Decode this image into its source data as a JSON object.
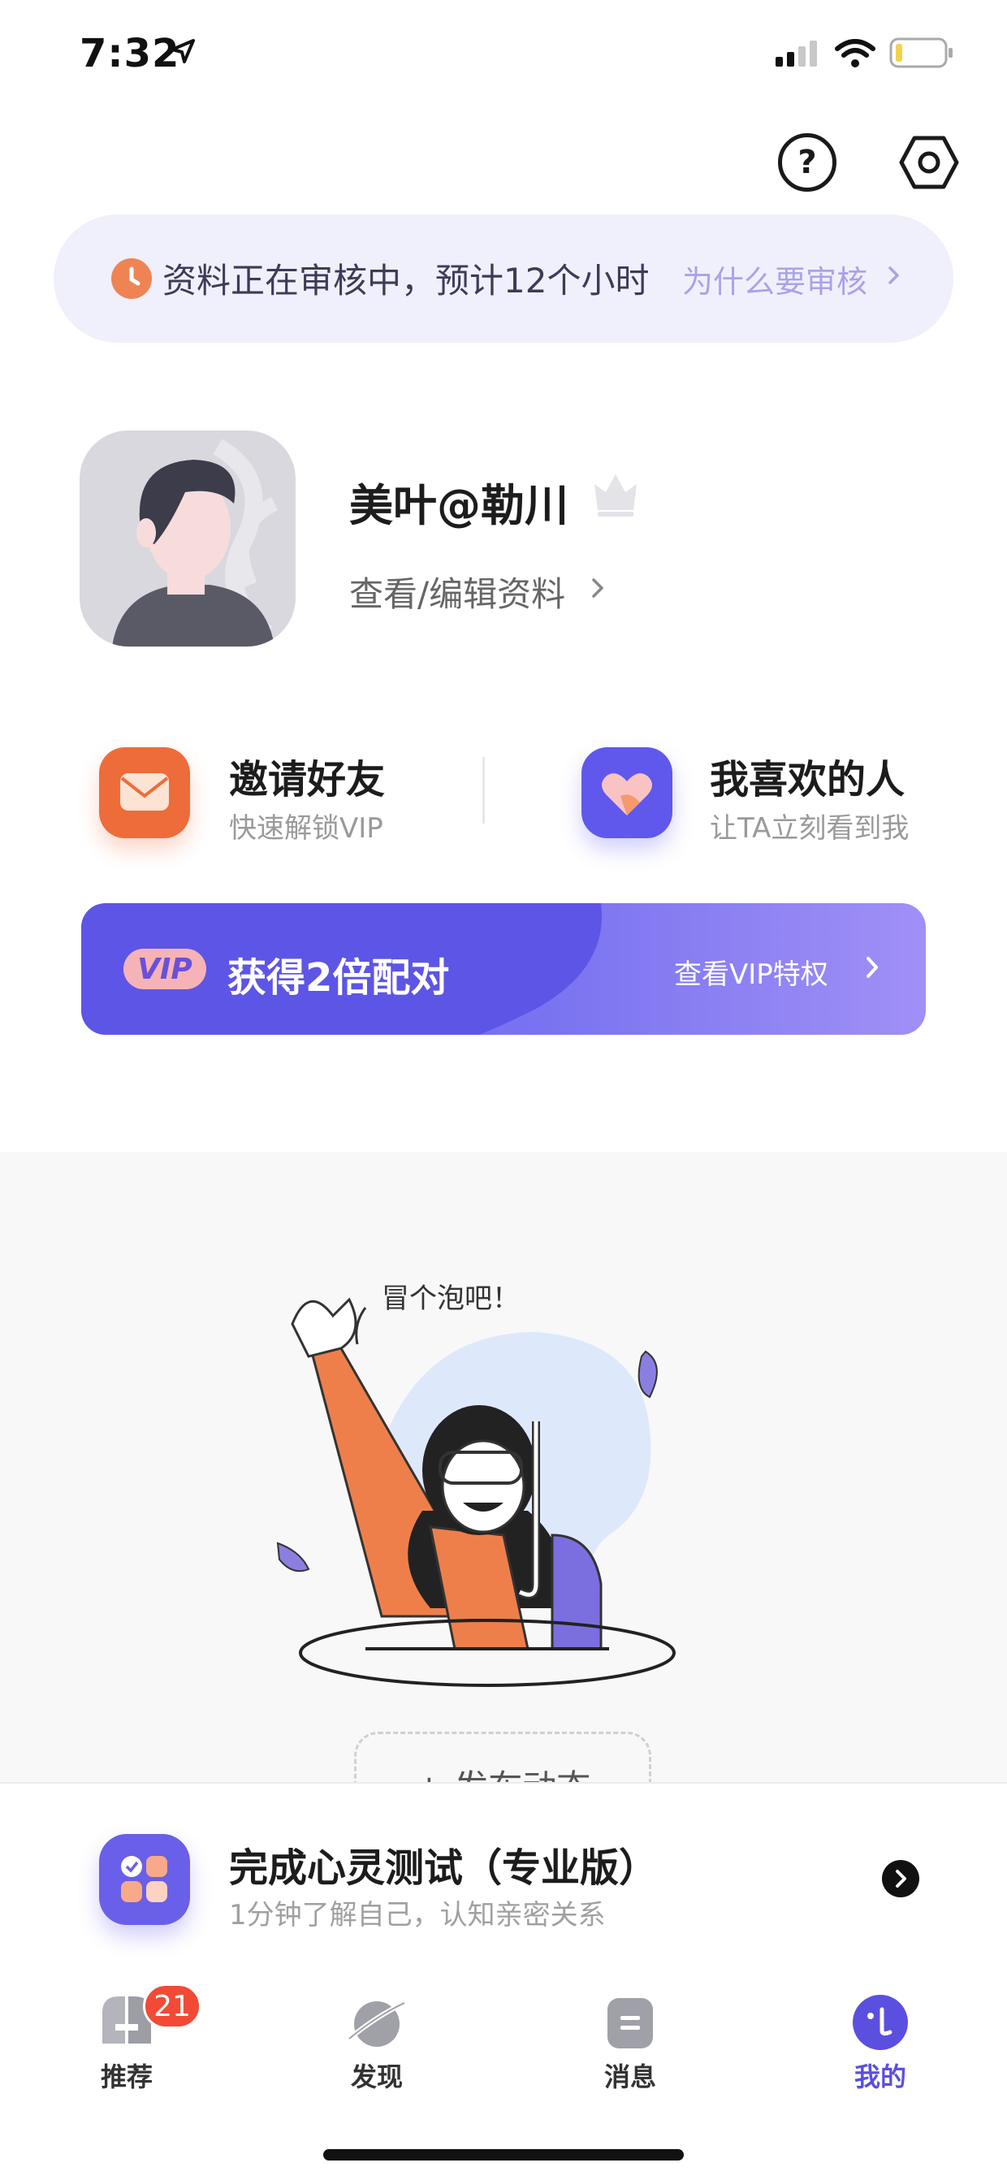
{
  "status_bar": {
    "time": "7:32"
  },
  "top_actions": {
    "help_label": "?"
  },
  "review_banner": {
    "text": "资料正在审核中，预计12个小时",
    "link": "为什么要审核"
  },
  "profile": {
    "name": "美叶@勒川",
    "edit_link": "查看/编辑资料"
  },
  "quick_actions": [
    {
      "title": "邀请好友",
      "subtitle": "快速解锁VIP"
    },
    {
      "title": "我喜欢的人",
      "subtitle": "让TA立刻看到我"
    }
  ],
  "vip_banner": {
    "badge": "VIP",
    "title": "获得2倍配对",
    "link": "查看VIP特权"
  },
  "feed_empty": {
    "bubble": "冒个泡吧！",
    "post_button": "+ 发布动态"
  },
  "test_card": {
    "title": "完成心灵测试（专业版）",
    "subtitle": "1分钟了解自己，认知亲密关系"
  },
  "tabs": [
    {
      "label": "推荐",
      "badge": "21",
      "active": false
    },
    {
      "label": "发现",
      "active": false
    },
    {
      "label": "消息",
      "active": false
    },
    {
      "label": "我的",
      "active": true
    }
  ],
  "colors": {
    "accent": "#5b4fe0",
    "invite": "#ee6c3a",
    "badge": "#f24a36",
    "review_link": "#a9a3e8"
  }
}
